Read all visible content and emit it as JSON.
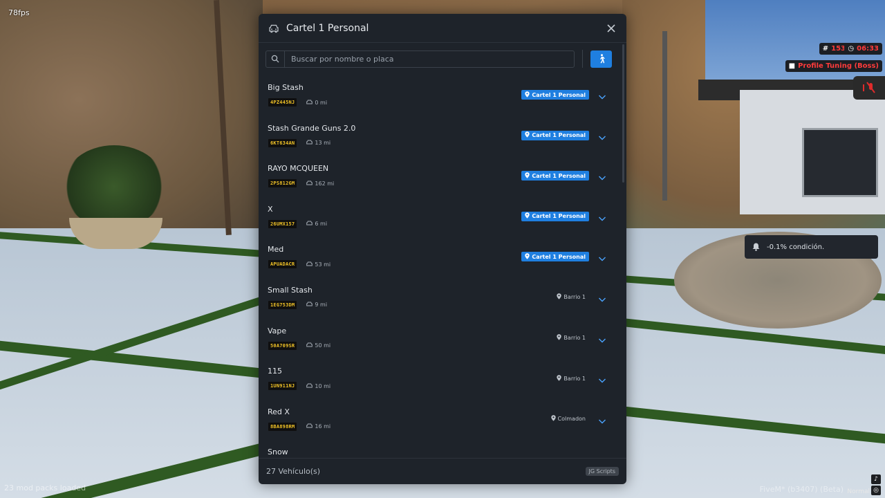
{
  "hud": {
    "fps": "78fps",
    "mods_loaded": "23 mod packs loaded",
    "fivem": "FiveM* (b3407) (Beta)",
    "player_id": "153",
    "time": "06:33",
    "job": "Profile Tuning (Boss)",
    "notification": "-0.1% condición.",
    "normal_label": "Normal"
  },
  "modal": {
    "title": "Cartel 1 Personal",
    "search_placeholder": "Buscar por nombre o placa",
    "footer_count": "27 Vehículo(s)",
    "footer_badge": "JG Scripts",
    "vehicles": [
      {
        "name": "Big Stash",
        "plate": "4PZ445NJ",
        "distance": "0 mi",
        "location": "Cartel 1 Personal",
        "highlight": true
      },
      {
        "name": "Stash Grande Guns 2.0",
        "plate": "6KT634AN",
        "distance": "13 mi",
        "location": "Cartel 1 Personal",
        "highlight": true
      },
      {
        "name": "RAYO MCQUEEN",
        "plate": "2PS812GM",
        "distance": "162 mi",
        "location": "Cartel 1 Personal",
        "highlight": true
      },
      {
        "name": "X",
        "plate": "26UMX157",
        "distance": "6 mi",
        "location": "Cartel 1 Personal",
        "highlight": true
      },
      {
        "name": "Med",
        "plate": "APUADACR",
        "distance": "53 mi",
        "location": "Cartel 1 Personal",
        "highlight": true
      },
      {
        "name": "Small Stash",
        "plate": "1EG753DM",
        "distance": "9 mi",
        "location": "Barrio 1",
        "highlight": false
      },
      {
        "name": "Vape",
        "plate": "50A709SR",
        "distance": "50 mi",
        "location": "Barrio 1",
        "highlight": false
      },
      {
        "name": "115",
        "plate": "1UN911NJ",
        "distance": "10 mi",
        "location": "Barrio 1",
        "highlight": false
      },
      {
        "name": "Red X",
        "plate": "8BA898RM",
        "distance": "16 mi",
        "location": "Colmadon",
        "highlight": false
      },
      {
        "name": "Snow",
        "plate": "",
        "distance": "",
        "location": "",
        "highlight": false
      }
    ]
  },
  "colors": {
    "accent": "#1f7fe0",
    "panel": "#1e232a",
    "plate_text": "#f0c227"
  }
}
